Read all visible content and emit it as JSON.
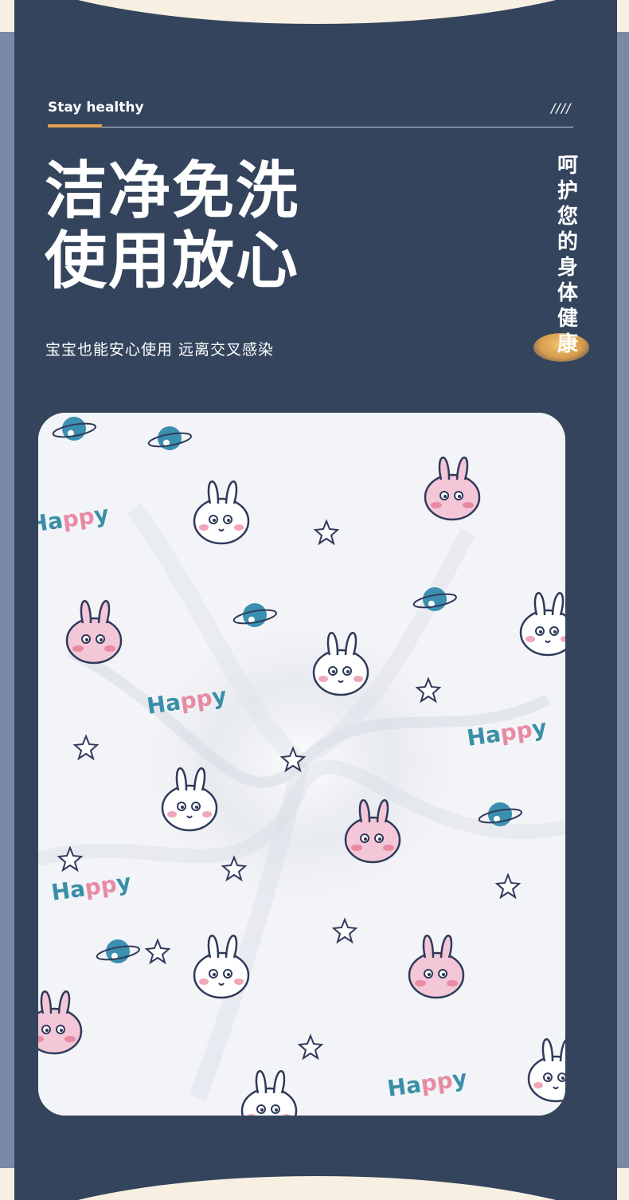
{
  "header": {
    "tagline": "Stay healthy",
    "decoration": "////"
  },
  "headline": {
    "line1": "洁净免洗",
    "line2": "使用放心"
  },
  "subtitle": "宝宝也能安心使用 远离交叉感染",
  "vertical_text": [
    "呵",
    "护",
    "您",
    "的",
    "身",
    "体",
    "健",
    "康"
  ],
  "photo": {
    "pattern_word": "Happy",
    "motifs": [
      "bunny-icon",
      "planet-icon",
      "star-icon"
    ]
  },
  "colors": {
    "background": "#33445c",
    "accent": "#e2a24d",
    "cream": "#f7efe1",
    "text": "#ffffff"
  }
}
